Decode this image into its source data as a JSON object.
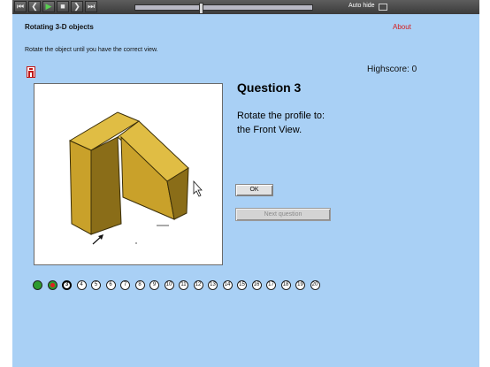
{
  "toolbar": {
    "buttons": [
      {
        "name": "skip-start-button",
        "icon": "skip-start-icon",
        "glyph": "⏮"
      },
      {
        "name": "step-back-button",
        "icon": "step-back-icon",
        "glyph": "❮"
      },
      {
        "name": "play-button",
        "icon": "play-icon",
        "glyph": "▶"
      },
      {
        "name": "stop-button",
        "icon": "stop-icon",
        "glyph": "■"
      },
      {
        "name": "step-forward-button",
        "icon": "step-forward-icon",
        "glyph": "❯"
      },
      {
        "name": "skip-end-button",
        "icon": "skip-end-icon",
        "glyph": "⏭"
      }
    ],
    "progress": 0.36,
    "autohide_label": "Auto hide"
  },
  "header": {
    "title": "Rotating 3-D objects",
    "about_label": "About",
    "instructions": "Rotate the object until you have the correct view.",
    "help_icon": "help-icon"
  },
  "highscore": "Highscore: 0",
  "question": {
    "title": "Question 3",
    "text_line1": "Rotate the profile to:",
    "text_line2": "the Front View."
  },
  "buttons": {
    "ok": "OK",
    "next": "Next question"
  },
  "circles": [
    {
      "label": "1",
      "state": "correct"
    },
    {
      "label": "2",
      "state": "wrong"
    },
    {
      "label": "3",
      "state": "current"
    },
    {
      "label": "4",
      "state": "pending"
    },
    {
      "label": "5",
      "state": "pending"
    },
    {
      "label": "6",
      "state": "pending"
    },
    {
      "label": "7",
      "state": "pending"
    },
    {
      "label": "8",
      "state": "pending"
    },
    {
      "label": "9",
      "state": "pending"
    },
    {
      "label": "10",
      "state": "pending"
    },
    {
      "label": "11",
      "state": "pending"
    },
    {
      "label": "12",
      "state": "pending"
    },
    {
      "label": "13",
      "state": "pending"
    },
    {
      "label": "14",
      "state": "pending"
    },
    {
      "label": "15",
      "state": "pending"
    },
    {
      "label": "16",
      "state": "pending"
    },
    {
      "label": "17",
      "state": "pending"
    },
    {
      "label": "18",
      "state": "pending"
    },
    {
      "label": "19",
      "state": "pending"
    },
    {
      "label": "20",
      "state": "pending"
    }
  ],
  "colors": {
    "background": "#a9d0f5",
    "about_link": "#d61a1a",
    "object_face_front": "#c9a12a",
    "object_face_top": "#e0bd44",
    "object_face_side": "#8a6d18",
    "correct": "#2e9b2e",
    "wrong": "#e02020"
  }
}
